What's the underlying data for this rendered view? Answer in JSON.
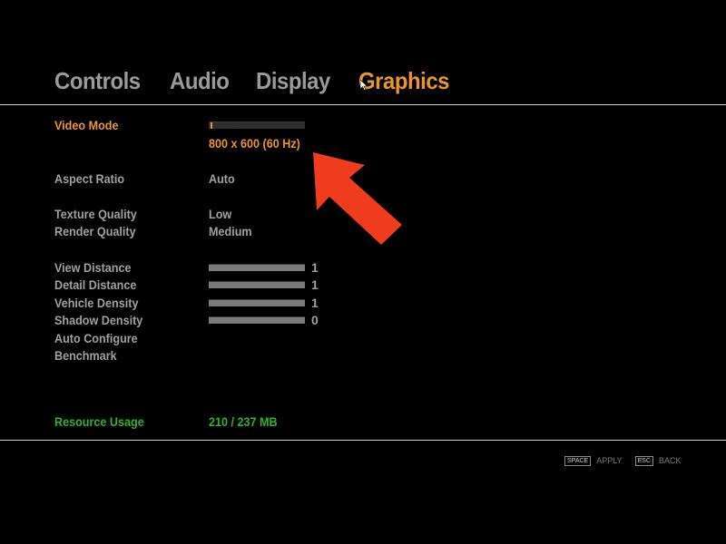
{
  "tabs": [
    {
      "label": "Controls",
      "active": false
    },
    {
      "label": "Audio",
      "active": false
    },
    {
      "label": "Display",
      "active": false
    },
    {
      "label": "Graphics",
      "active": true
    }
  ],
  "video_mode": {
    "label": "Video Mode",
    "value": "800 x 600 (60 Hz)",
    "slider_level": 0.02
  },
  "aspect_ratio": {
    "label": "Aspect Ratio",
    "value": "Auto"
  },
  "texture_quality": {
    "label": "Texture Quality",
    "value": "Low"
  },
  "render_quality": {
    "label": "Render Quality",
    "value": "Medium"
  },
  "sliders": [
    {
      "label": "View Distance",
      "value": "1",
      "level": 1.0
    },
    {
      "label": "Detail Distance",
      "value": "1",
      "level": 1.0
    },
    {
      "label": "Vehicle Density",
      "value": "1",
      "level": 1.0
    },
    {
      "label": "Shadow Density",
      "value": "0",
      "level": 1.0
    }
  ],
  "auto_configure": {
    "label": "Auto Configure"
  },
  "benchmark": {
    "label": "Benchmark"
  },
  "resource_usage": {
    "label": "Resource Usage",
    "value": "210 / 237 MB"
  },
  "hints": {
    "apply_key": "SPACE",
    "apply_label": "APPLY",
    "back_key": "ESC",
    "back_label": "BACK"
  },
  "colors": {
    "accent": "#e8962e",
    "inactive": "#a0a0a0",
    "resource": "#2fb32f",
    "annotation_arrow": "#f03c1e"
  },
  "icons": [
    "mouse-cursor-icon",
    "annotation-arrow-icon"
  ]
}
